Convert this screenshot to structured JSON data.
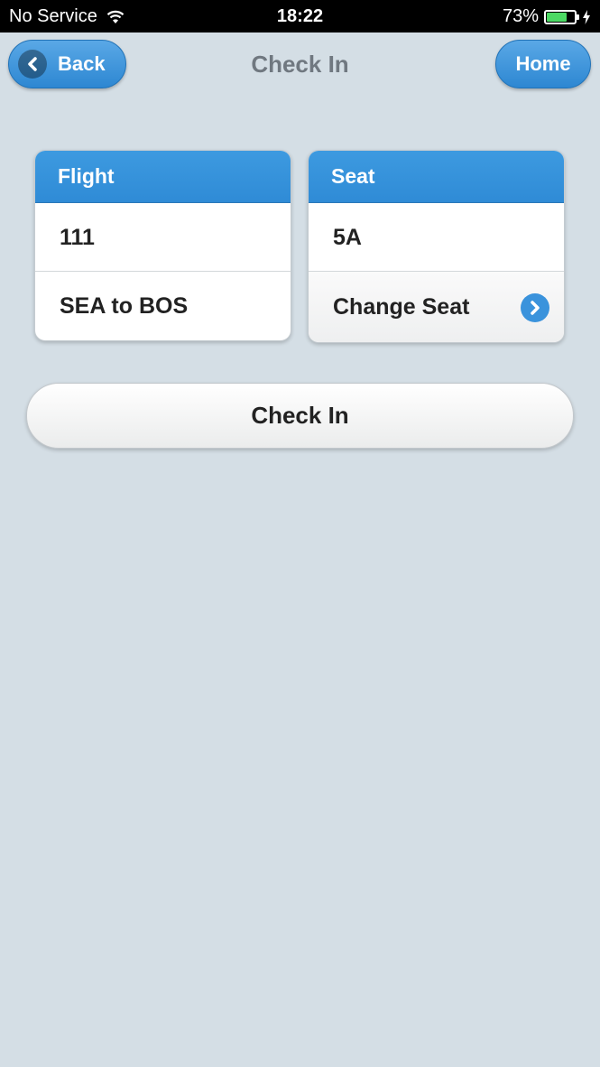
{
  "status_bar": {
    "carrier": "No Service",
    "time": "18:22",
    "battery": "73%",
    "battery_level": 0.73,
    "wifi_icon": "wifi-icon",
    "charging_icon": "bolt-icon"
  },
  "header": {
    "title": "Check In",
    "back_label": "Back",
    "home_label": "Home",
    "accent_color": "#3a93dc"
  },
  "flight_card": {
    "heading": "Flight",
    "number": "111",
    "route": "SEA to BOS"
  },
  "seat_card": {
    "heading": "Seat",
    "seat": "5A",
    "change_label": "Change Seat",
    "change_icon": "chevron-right-circle-icon"
  },
  "checkin_button": {
    "label": "Check In"
  }
}
